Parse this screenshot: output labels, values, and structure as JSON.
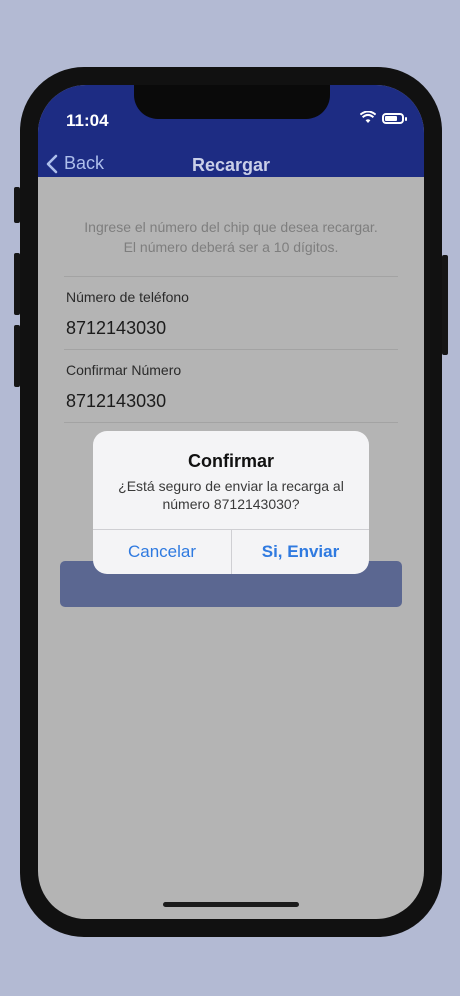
{
  "status_bar": {
    "time": "11:04"
  },
  "nav": {
    "back_label": "Back",
    "title": "Recargar"
  },
  "instructions": {
    "line1": "Ingrese el número del chip que desea recargar.",
    "line2": "El número deberá ser a 10 dígitos."
  },
  "form": {
    "phone_label": "Número de teléfono",
    "phone_value": "8712143030",
    "confirm_label": "Confirmar Número",
    "confirm_value": "8712143030"
  },
  "alert": {
    "title": "Confirmar",
    "message_line1": "¿Está seguro de enviar la recarga al",
    "message_line2": "número 8712143030?",
    "cancel_label": "Cancelar",
    "confirm_label": "Si, Enviar"
  },
  "colors": {
    "nav_bar": "#1d2c83",
    "dim_background": "#b4b4b4",
    "alert_accent": "#2f7ae0",
    "page_background": "#b3bad3"
  }
}
